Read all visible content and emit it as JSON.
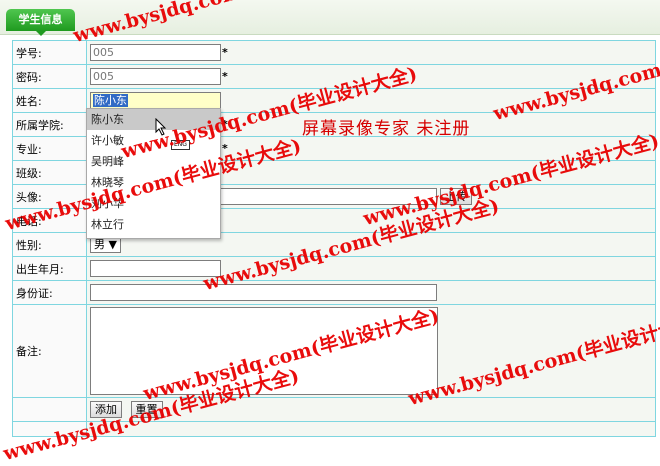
{
  "tab": {
    "title": "学生信息"
  },
  "form": {
    "fields": [
      {
        "label": "学号:",
        "value": "005",
        "required": "*"
      },
      {
        "label": "密码:",
        "value": "005",
        "required": "*"
      },
      {
        "label": "姓名:",
        "value": "陈小东"
      },
      {
        "label": "所属学院:",
        "required": "*"
      },
      {
        "label": "专业:",
        "required": "*"
      },
      {
        "label": "班级:"
      },
      {
        "label": "头像:",
        "upload_button": "上传"
      },
      {
        "label": "电话:"
      },
      {
        "label": "性别:",
        "value": "男"
      },
      {
        "label": "出生年月:"
      },
      {
        "label": "身份证:"
      },
      {
        "label": "备注:"
      }
    ],
    "buttons": {
      "add": "添加",
      "reset": "重置"
    }
  },
  "autocomplete": {
    "items": [
      "陈小东",
      "许小敏",
      "吴明峰",
      "林晓琴",
      "刘小华",
      "林立行"
    ],
    "highlighted_index": 0
  },
  "overlay": {
    "recorder_text": "屏幕录像专家  未注册",
    "badge": "ENG"
  },
  "watermark": {
    "text": "www.bysjdq.com(毕业设计大全)"
  }
}
